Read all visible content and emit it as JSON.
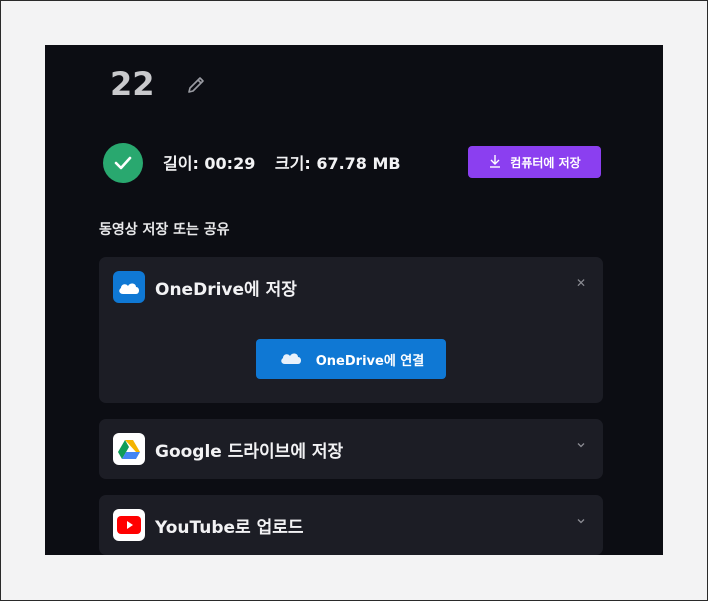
{
  "header": {
    "title": "22"
  },
  "info": {
    "length": "길이: 00:29",
    "size": "크기: 67.78 MB",
    "save_to_pc_label": "컴퓨터에 저장"
  },
  "share": {
    "section_label": "동영상 저장 또는 공유",
    "onedrive": {
      "title": "OneDrive에 저장",
      "connect_label": "OneDrive에 연결"
    },
    "google": {
      "title": "Google 드라이브에 저장"
    },
    "youtube": {
      "title": "YouTube로 업로드"
    }
  },
  "colors": {
    "panel_bg": "#0c0d13",
    "card_bg": "#1c1d25",
    "accent_purple": "#8b3ff0",
    "onedrive_blue": "#0f78d4",
    "success_green": "#29a86f"
  },
  "icons": [
    "pencil-icon",
    "checkmark-icon",
    "download-icon",
    "onedrive-cloud-icon",
    "close-icon",
    "google-drive-icon",
    "youtube-icon",
    "chevron-down-icon"
  ]
}
